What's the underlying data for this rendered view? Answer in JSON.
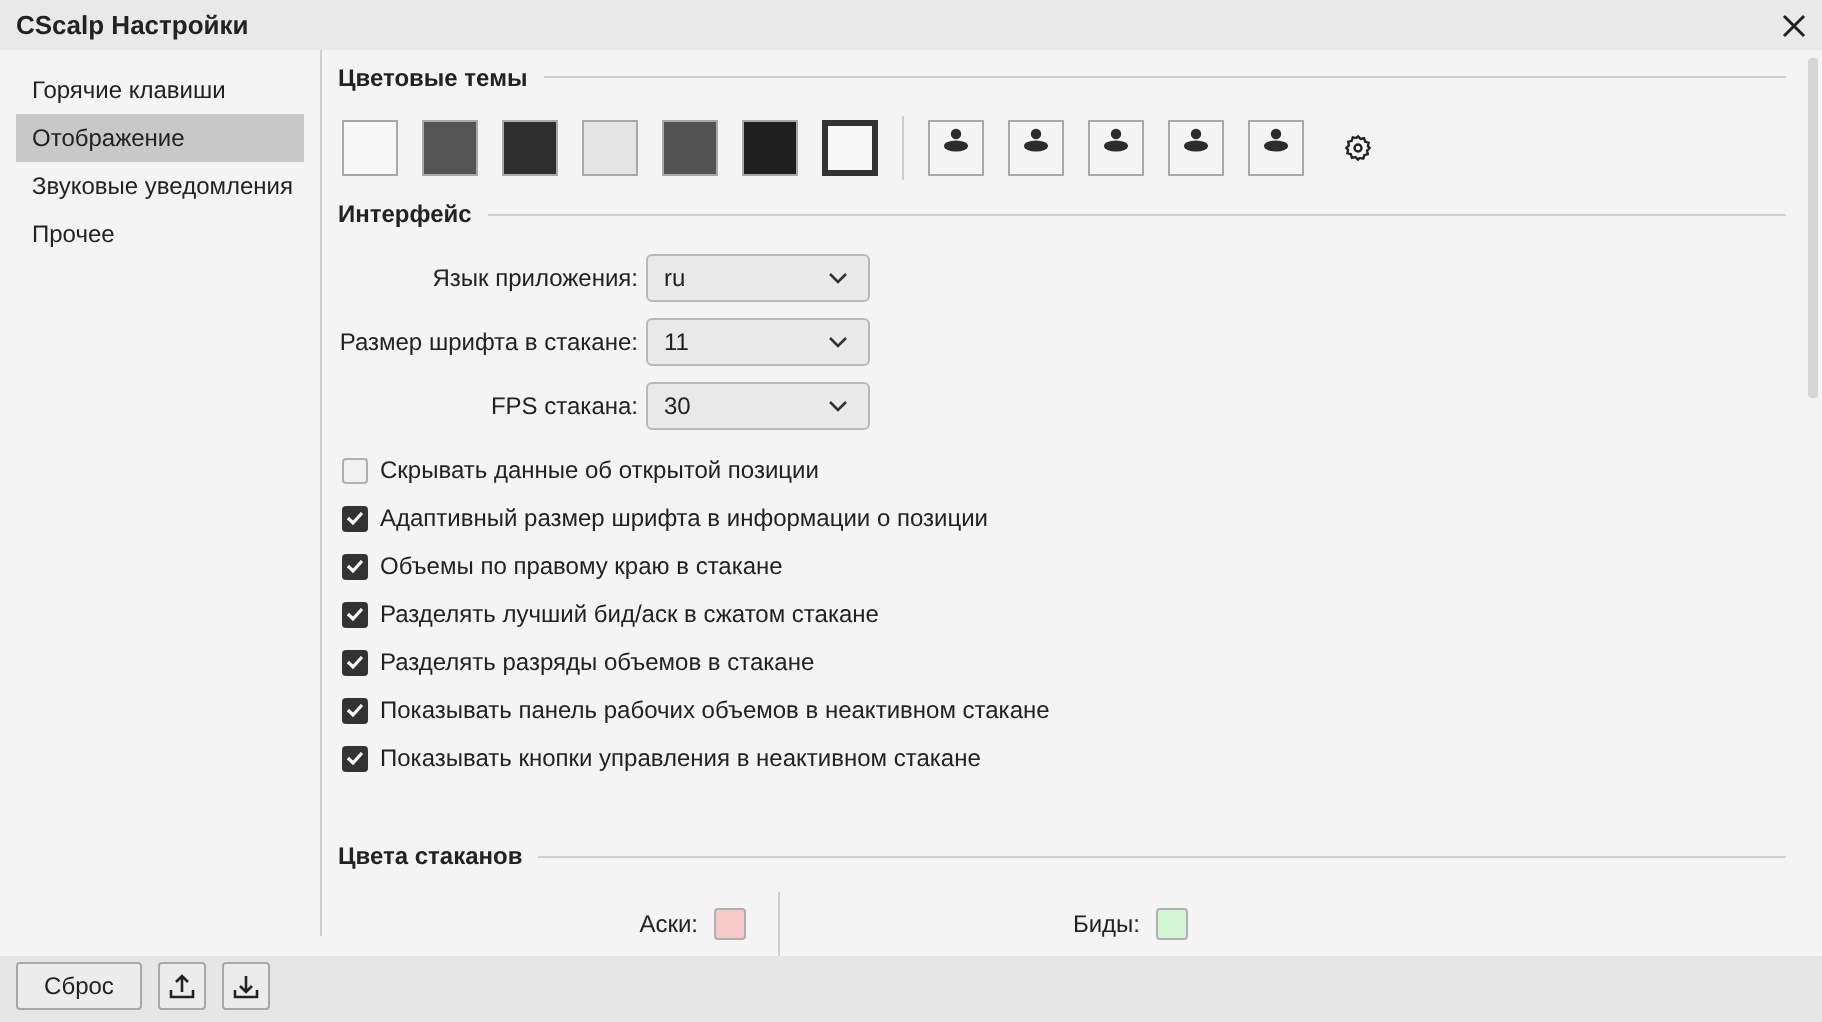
{
  "window": {
    "title": "CScalp Настройки"
  },
  "sidebar": {
    "items": [
      {
        "label": "Горячие клавиши",
        "selected": false
      },
      {
        "label": "Отображение",
        "selected": true
      },
      {
        "label": "Звуковые уведомления",
        "selected": false
      },
      {
        "label": "Прочее",
        "selected": false
      }
    ]
  },
  "color_themes": {
    "title": "Цветовые темы",
    "swatches": [
      {
        "color": "#f7f7f7",
        "selected": false
      },
      {
        "color": "#545454",
        "selected": false
      },
      {
        "color": "#2e2e2e",
        "selected": false
      },
      {
        "color": "#e4e4e4",
        "selected": false
      },
      {
        "color": "#525252",
        "selected": false
      },
      {
        "color": "#1f1f1f",
        "selected": false
      },
      {
        "color": "#f7f7f7",
        "selected": true
      }
    ],
    "custom_themes": [
      {
        "selected": false
      },
      {
        "selected": false
      },
      {
        "selected": false
      },
      {
        "selected": false
      },
      {
        "selected": false
      }
    ]
  },
  "interface": {
    "title": "Интерфейс",
    "dropdowns": [
      {
        "label": "Язык приложения:",
        "value": "ru"
      },
      {
        "label": "Размер шрифта в стакане:",
        "value": "11"
      },
      {
        "label": "FPS стакана:",
        "value": "30"
      }
    ],
    "checkboxes": [
      {
        "label": "Скрывать данные об открытой позиции",
        "checked": false
      },
      {
        "label": "Адаптивный размер шрифта в информации о позиции",
        "checked": true
      },
      {
        "label": "Объемы по правому краю в стакане",
        "checked": true
      },
      {
        "label": "Разделять лучший бид/аск в сжатом стакане",
        "checked": true
      },
      {
        "label": "Разделять разряды объемов в стакане",
        "checked": true
      },
      {
        "label": "Показывать панель рабочих объемов в неактивном стакане",
        "checked": true
      },
      {
        "label": "Показывать кнопки управления в неактивном стакане",
        "checked": true
      }
    ]
  },
  "book_colors": {
    "title": "Цвета стаканов",
    "items": [
      {
        "label": "Аски:",
        "color": "#f7caca"
      },
      {
        "label": "Биды:",
        "color": "#d2f5d2"
      }
    ]
  },
  "footer": {
    "reset_button": "Сброс"
  }
}
